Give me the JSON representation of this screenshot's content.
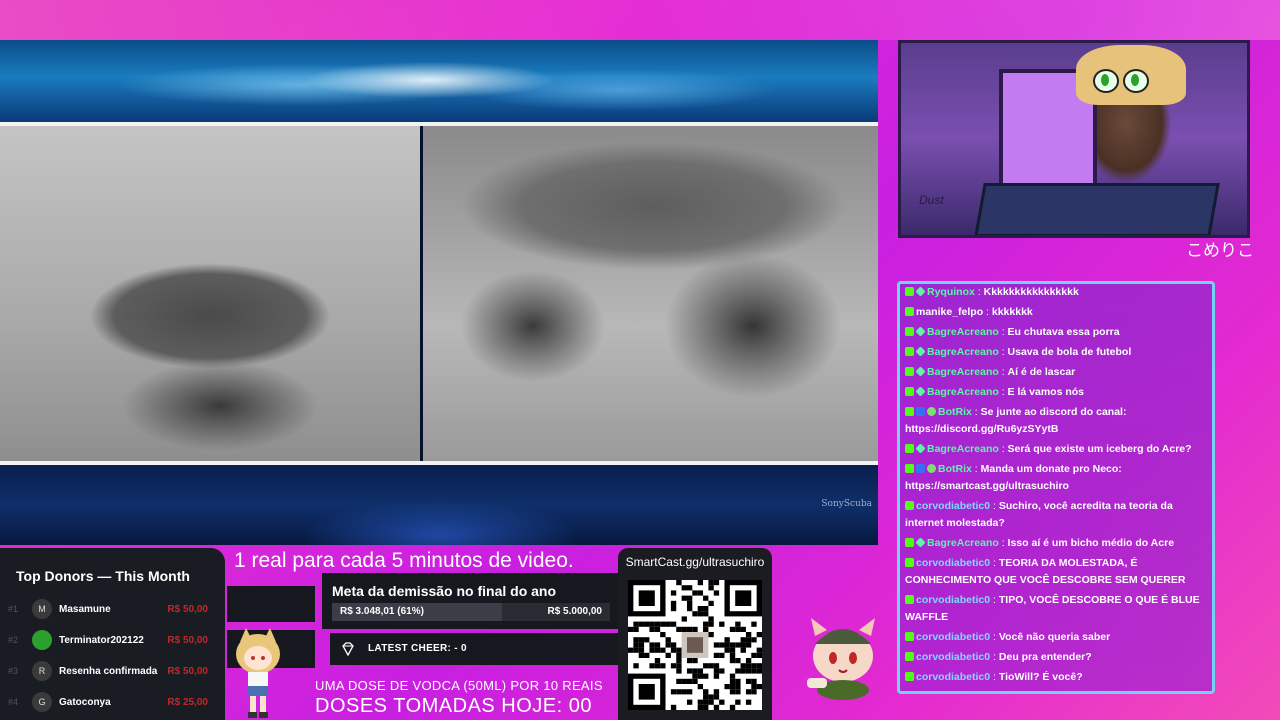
{
  "video": {
    "watermark": "SonyScuba"
  },
  "camera": {
    "sign": "Dust"
  },
  "deco_text": "こめりこ",
  "chat": {
    "messages": [
      {
        "user": "Ryquinox",
        "color": "#5ef5a8",
        "badges": [
          "kick",
          "gem"
        ],
        "text": "Kkkkkkkkkkkkkkkk"
      },
      {
        "user": "manike_felpo",
        "color": "#ffffff",
        "badges": [
          "kick"
        ],
        "text": "kkkkkkk"
      },
      {
        "user": "BagreAcreano",
        "color": "#5ef5a8",
        "badges": [
          "kick",
          "gem"
        ],
        "text": "Eu chutava essa porra"
      },
      {
        "user": "BagreAcreano",
        "color": "#5ef5a8",
        "badges": [
          "kick",
          "gem"
        ],
        "text": "Usava de bola de futebol"
      },
      {
        "user": "BagreAcreano",
        "color": "#5ef5a8",
        "badges": [
          "kick",
          "gem"
        ],
        "text": "Aí é de lascar"
      },
      {
        "user": "BagreAcreano",
        "color": "#5ef5a8",
        "badges": [
          "kick",
          "gem"
        ],
        "text": "E lá vamos nós"
      },
      {
        "user": "BotRix",
        "color": "#5ef5a8",
        "badges": [
          "kick",
          "bot",
          "check"
        ],
        "text": "Se junte ao discord do canal: https://discord.gg/Ru6yzSYytB"
      },
      {
        "user": "BagreAcreano",
        "color": "#5ef5a8",
        "badges": [
          "kick",
          "gem"
        ],
        "text": "Será que existe um iceberg do Acre?"
      },
      {
        "user": "BotRix",
        "color": "#5ef5a8",
        "badges": [
          "kick",
          "bot",
          "check"
        ],
        "text": "Manda um donate pro Neco: https://smartcast.gg/ultrasuchiro"
      },
      {
        "user": "corvodiabetic0",
        "color": "#7fd8ff",
        "badges": [
          "kick"
        ],
        "text": "Suchiro, você acredita na teoria da internet molestada?"
      },
      {
        "user": "BagreAcreano",
        "color": "#5ef5a8",
        "badges": [
          "kick",
          "gem"
        ],
        "text": "Isso aí é um bicho médio do Acre"
      },
      {
        "user": "corvodiabetic0",
        "color": "#7fd8ff",
        "badges": [
          "kick"
        ],
        "text": "TEORIA DA MOLESTADA, É CONHECIMENTO QUE VOCÊ DESCOBRE SEM QUERER"
      },
      {
        "user": "corvodiabetic0",
        "color": "#7fd8ff",
        "badges": [
          "kick"
        ],
        "text": "TIPO, VOCÊ DESCOBRE O QUE É BLUE WAFFLE"
      },
      {
        "user": "corvodiabetic0",
        "color": "#7fd8ff",
        "badges": [
          "kick"
        ],
        "text": "Você não queria saber"
      },
      {
        "user": "corvodiabetic0",
        "color": "#7fd8ff",
        "badges": [
          "kick"
        ],
        "text": "Deu pra entender?"
      },
      {
        "user": "corvodiabetic0",
        "color": "#7fd8ff",
        "badges": [
          "kick"
        ],
        "text": "TioWill? É você?"
      }
    ]
  },
  "donors": {
    "title": "Top Donors — This Month",
    "list": [
      {
        "rank": "#1",
        "initial": "M",
        "name": "Masamune",
        "amount": "R$ 50,00"
      },
      {
        "rank": "#2",
        "initial": "",
        "name": "Terminator202122",
        "amount": "R$ 50,00"
      },
      {
        "rank": "#3",
        "initial": "R",
        "name": "Resenha confirmada",
        "amount": "R$ 50,00"
      },
      {
        "rank": "#4",
        "initial": "G",
        "name": "Gatoconya",
        "amount": "R$ 25,00"
      }
    ]
  },
  "promo": "1 real para cada 5 minutos de video.",
  "goal": {
    "title": "Meta da demissão no final do ano",
    "current": "R$ 3.048,01 (61%)",
    "max": "R$ 5.000,00",
    "progress": 0.61
  },
  "cheer": {
    "label": "LATEST CHEER: - 0"
  },
  "doses": {
    "line1": "UMA DOSE DE VODCA (50ML) POR 10 REAIS",
    "line2": "DOSES TOMADAS HOJE: 00"
  },
  "qr": {
    "url": "SmartCast.gg/ultrasuchiro"
  }
}
